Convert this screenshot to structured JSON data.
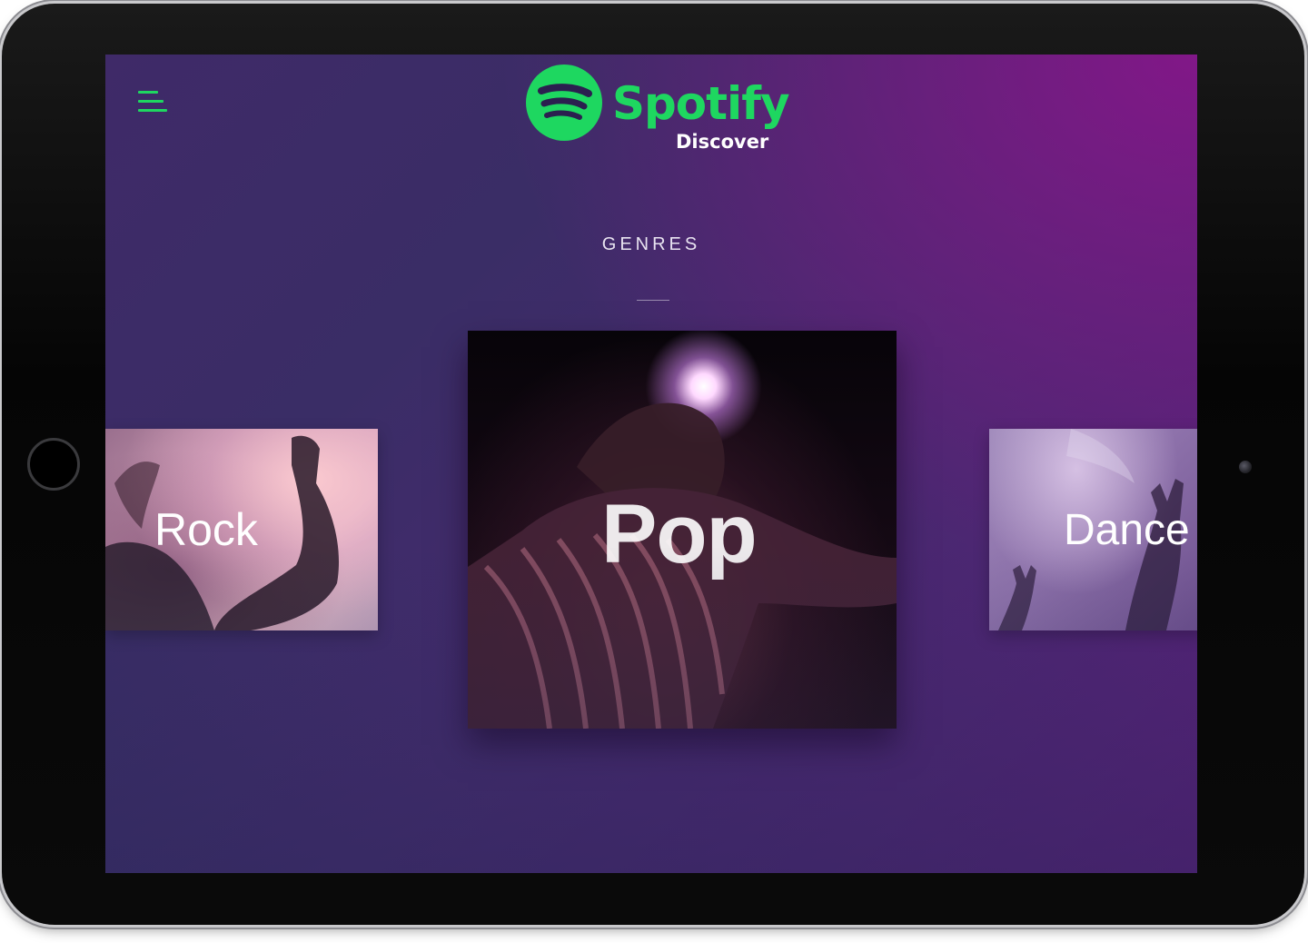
{
  "app": {
    "brand_name": "Spotify",
    "brand_subtitle": "Discover",
    "accent_color": "#1ed760"
  },
  "menu": {
    "icon": "hamburger-menu-icon"
  },
  "section": {
    "title": "GENRES"
  },
  "genres": [
    {
      "label": "Rock",
      "state": "previous"
    },
    {
      "label": "Pop",
      "state": "active"
    },
    {
      "label": "Dance",
      "state": "next"
    }
  ],
  "device": {
    "type": "tablet",
    "home_button_icon": "home-button-icon",
    "camera_icon": "front-camera-icon"
  }
}
